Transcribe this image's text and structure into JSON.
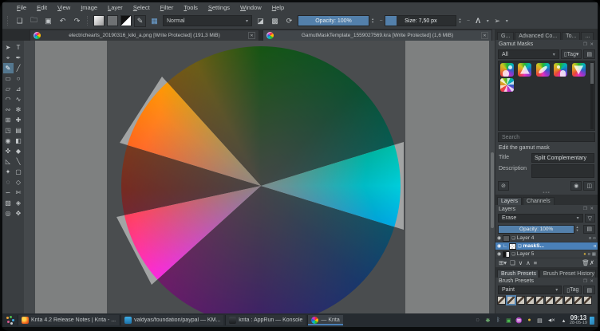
{
  "window": {
    "app": "Krita"
  },
  "colors": {
    "selection_blue": "#4a80b8",
    "slider_blue": "#5380ab",
    "canvas_board": "#4a4d4f",
    "canvas_background": "#7e8080",
    "wheel_hues": [
      "#23991f",
      "#128f56",
      "#00b2bc",
      "#2a63c4",
      "#6d38bd",
      "#c531be",
      "#d84a3a",
      "#e2802a",
      "#c2a622"
    ]
  },
  "menubar": {
    "items": [
      "File",
      "Edit",
      "View",
      "Image",
      "Layer",
      "Select",
      "Filter",
      "Tools",
      "Settings",
      "Window",
      "Help"
    ]
  },
  "toolbar": {
    "blend_mode": "Normal",
    "opacity_label": "Opacity:  100%",
    "opacity_percent": 100,
    "size_label": "Size:  7,50 px",
    "size_fill_percent": 16
  },
  "doc_tabs": [
    {
      "title": "electrichearts_20190316_kiki_a.png [Write Protected]  (191,3 MiB)",
      "active": false
    },
    {
      "title": "GamutMaskTemplate_1559027569.kra [Write Protected]  (1,6 MiB)",
      "active": true
    }
  ],
  "toolbox": {
    "tools": [
      {
        "name": "select-shapes-tool",
        "glyph": "➤",
        "sel": false
      },
      {
        "name": "text-tool",
        "glyph": "T",
        "sel": false
      },
      {
        "name": "edit-shapes-tool",
        "glyph": "⌖",
        "sel": false
      },
      {
        "name": "calligraphy-tool",
        "glyph": "✒",
        "sel": false
      },
      {
        "name": "freehand-brush-tool",
        "glyph": "✎",
        "sel": true
      },
      {
        "name": "line-tool",
        "glyph": "╱",
        "sel": false
      },
      {
        "name": "rectangle-tool",
        "glyph": "▭",
        "sel": false
      },
      {
        "name": "ellipse-tool",
        "glyph": "○",
        "sel": false
      },
      {
        "name": "polygon-tool",
        "glyph": "▱",
        "sel": false
      },
      {
        "name": "polyline-tool",
        "glyph": "⊿",
        "sel": false
      },
      {
        "name": "bezier-curve-tool",
        "glyph": "◠",
        "sel": false
      },
      {
        "name": "freehand-path-tool",
        "glyph": "∿",
        "sel": false
      },
      {
        "name": "dynamic-brush-tool",
        "glyph": "∾",
        "sel": false
      },
      {
        "name": "multibrush-tool",
        "glyph": "✻",
        "sel": false
      },
      {
        "name": "transform-tool",
        "glyph": "⊞",
        "sel": false
      },
      {
        "name": "move-tool",
        "glyph": "✚",
        "sel": false
      },
      {
        "name": "crop-tool",
        "glyph": "◳",
        "sel": false
      },
      {
        "name": "gradient-tool",
        "glyph": "▤",
        "sel": false
      },
      {
        "name": "color-sampler-tool",
        "glyph": "◉",
        "sel": false
      },
      {
        "name": "pattern-edit-tool",
        "glyph": "◧",
        "sel": false
      },
      {
        "name": "smart-patch-tool",
        "glyph": "✜",
        "sel": false
      },
      {
        "name": "fill-tool",
        "glyph": "◆",
        "sel": false
      },
      {
        "name": "assistants-tool",
        "glyph": "◺",
        "sel": false
      },
      {
        "name": "measure-tool",
        "glyph": "╲",
        "sel": false
      },
      {
        "name": "reference-images-tool",
        "glyph": "✦",
        "sel": false
      },
      {
        "name": "rect-select-tool",
        "glyph": "▢",
        "sel": false
      },
      {
        "name": "ellipse-select-tool",
        "glyph": "◌",
        "sel": false
      },
      {
        "name": "polygon-select-tool",
        "glyph": "◇",
        "sel": false
      },
      {
        "name": "freehand-select-tool",
        "glyph": "∽",
        "sel": false
      },
      {
        "name": "magnetic-select-tool",
        "glyph": "✄",
        "sel": false
      },
      {
        "name": "similar-select-tool",
        "glyph": "▨",
        "sel": false
      },
      {
        "name": "bezier-select-tool",
        "glyph": "◈",
        "sel": false
      },
      {
        "name": "zoom-tool",
        "glyph": "◎",
        "sel": false
      },
      {
        "name": "pan-tool",
        "glyph": "✥",
        "sel": false
      }
    ]
  },
  "panel": {
    "tabs": [
      {
        "label": "G...",
        "active": false
      },
      {
        "label": "Advanced Co...",
        "active": false
      },
      {
        "label": "To...",
        "active": false
      },
      {
        "label": "...",
        "active": false
      }
    ],
    "gamut_masks": {
      "title": "Gamut Masks",
      "filter_value": "All",
      "tag_label": "Tag",
      "thumbnails": [
        "mask-blobs",
        "mask-triangle",
        "mask-lens",
        "mask-dot-ellipse",
        "mask-triangle-2",
        "mask-pinwheel"
      ],
      "search_placeholder": "Search",
      "heading": "Edit the gamut mask",
      "title_label": "Title",
      "title_value": "Split Complementary",
      "description_label": "Description",
      "description_value": ""
    },
    "layers": {
      "tabs": [
        {
          "label": "Layers",
          "active": true
        },
        {
          "label": "Channels",
          "active": false
        }
      ],
      "title": "Layers",
      "blend_mode": "Erase",
      "opacity_label": "Opacity:  100%",
      "opacity_percent": 100,
      "rows": [
        {
          "label": "Layer 4",
          "selected": false,
          "thumb": "dark",
          "child": false,
          "badges": [
            "α",
            "∞"
          ]
        },
        {
          "label": "maskS...",
          "selected": true,
          "thumb": "checker",
          "child": true,
          "badges": [
            "α"
          ]
        },
        {
          "label": "Layer 5",
          "selected": false,
          "thumb": "bw",
          "child": false,
          "badges": [
            "●",
            "α",
            "▦"
          ]
        }
      ]
    },
    "brush_presets": {
      "tabs": [
        {
          "label": "Brush Presets",
          "active": true
        },
        {
          "label": "Brush Preset History",
          "active": false
        }
      ],
      "title": "Brush Presets",
      "filter_value": "Paint",
      "tag_label": "Tag",
      "items": [
        {
          "selected": false
        },
        {
          "selected": true
        },
        {
          "selected": false
        },
        {
          "selected": false
        },
        {
          "selected": false
        },
        {
          "selected": false
        },
        {
          "selected": false
        },
        {
          "selected": false
        },
        {
          "selected": false
        },
        {
          "selected": false
        }
      ]
    }
  },
  "taskbar": {
    "items": [
      {
        "label": "Krita 4.2 Release Notes | Krita - ...",
        "icon": "firefox-icon",
        "active": false
      },
      {
        "label": "valdyas/foundation/paypal — KM...",
        "icon": "kmail-icon",
        "active": false
      },
      {
        "label": "krita : AppRun — Konsole",
        "icon": "konsole-icon",
        "active": false
      },
      {
        "label": "— Krita",
        "icon": "krita-icon",
        "active": true
      }
    ],
    "tray": [
      "status-circle-icon",
      "color-wheel-icon",
      "bluetooth-icon",
      "display-icon",
      "wifi-icon",
      "lock-icon",
      "clipboard-icon",
      "volume-muted-icon",
      "tray-expand-icon"
    ],
    "clock": {
      "time": "09:13",
      "date": "28-05-19"
    }
  }
}
